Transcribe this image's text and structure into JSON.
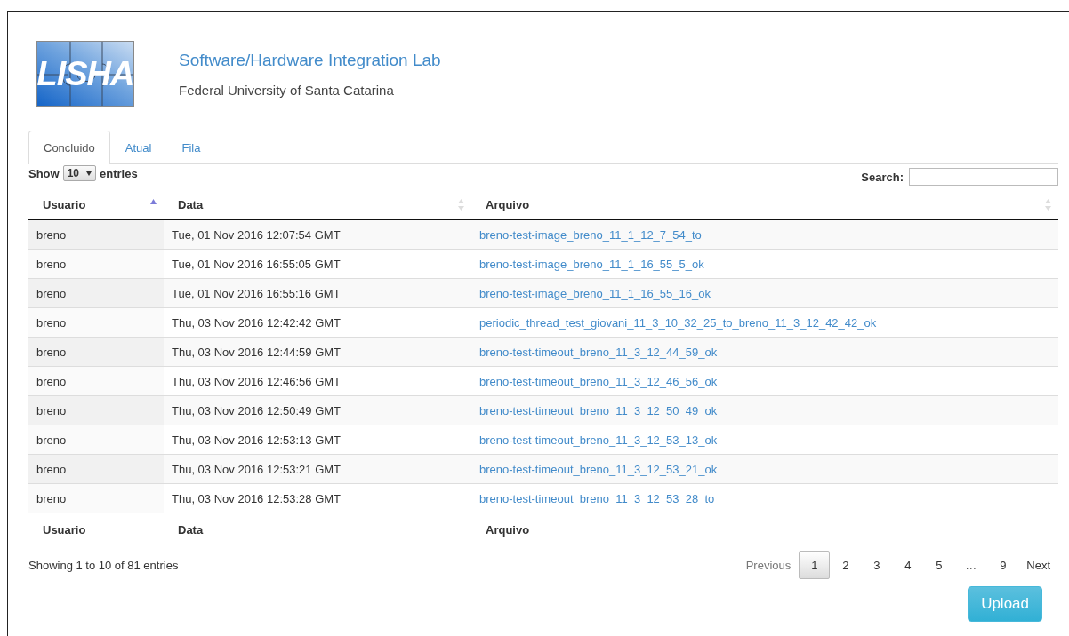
{
  "header": {
    "logo_text": "LISHA",
    "title": "Software/Hardware Integration Lab",
    "subtitle": "Federal University of Santa Catarina"
  },
  "tabs": [
    {
      "label": "Concluido",
      "selected": true
    },
    {
      "label": "Atual",
      "selected": false
    },
    {
      "label": "Fila",
      "selected": false
    }
  ],
  "length_menu": {
    "before": "Show",
    "value": "10",
    "after": "entries"
  },
  "search": {
    "label": "Search:"
  },
  "table": {
    "columns": [
      {
        "label": "Usuario",
        "sorted": true
      },
      {
        "label": "Data",
        "sorted": false
      },
      {
        "label": "Arquivo",
        "sorted": false
      }
    ],
    "rows": [
      {
        "user": "breno",
        "date": "Tue, 01 Nov 2016 12:07:54 GMT",
        "file": "breno-test-image_breno_11_1_12_7_54_to"
      },
      {
        "user": "breno",
        "date": "Tue, 01 Nov 2016 16:55:05 GMT",
        "file": "breno-test-image_breno_11_1_16_55_5_ok"
      },
      {
        "user": "breno",
        "date": "Tue, 01 Nov 2016 16:55:16 GMT",
        "file": "breno-test-image_breno_11_1_16_55_16_ok"
      },
      {
        "user": "breno",
        "date": "Thu, 03 Nov 2016 12:42:42 GMT",
        "file": "periodic_thread_test_giovani_11_3_10_32_25_to_breno_11_3_12_42_42_ok"
      },
      {
        "user": "breno",
        "date": "Thu, 03 Nov 2016 12:44:59 GMT",
        "file": "breno-test-timeout_breno_11_3_12_44_59_ok"
      },
      {
        "user": "breno",
        "date": "Thu, 03 Nov 2016 12:46:56 GMT",
        "file": "breno-test-timeout_breno_11_3_12_46_56_ok"
      },
      {
        "user": "breno",
        "date": "Thu, 03 Nov 2016 12:50:49 GMT",
        "file": "breno-test-timeout_breno_11_3_12_50_49_ok"
      },
      {
        "user": "breno",
        "date": "Thu, 03 Nov 2016 12:53:13 GMT",
        "file": "breno-test-timeout_breno_11_3_12_53_13_ok"
      },
      {
        "user": "breno",
        "date": "Thu, 03 Nov 2016 12:53:21 GMT",
        "file": "breno-test-timeout_breno_11_3_12_53_21_ok"
      },
      {
        "user": "breno",
        "date": "Thu, 03 Nov 2016 12:53:28 GMT",
        "file": "breno-test-timeout_breno_11_3_12_53_28_to"
      }
    ],
    "footer": [
      "Usuario",
      "Data",
      "Arquivo"
    ]
  },
  "info": "Showing 1 to 10 of 81 entries",
  "pagination": [
    {
      "label": "Previous",
      "kind": "prev",
      "disabled": true
    },
    {
      "label": "1",
      "kind": "page",
      "selected": true
    },
    {
      "label": "2",
      "kind": "page",
      "selected": false
    },
    {
      "label": "3",
      "kind": "page",
      "selected": false
    },
    {
      "label": "4",
      "kind": "page",
      "selected": false
    },
    {
      "label": "5",
      "kind": "page",
      "selected": false
    },
    {
      "label": "…",
      "kind": "ellipsis"
    },
    {
      "label": "9",
      "kind": "page",
      "selected": false
    },
    {
      "label": "Next",
      "kind": "next",
      "disabled": false
    }
  ],
  "upload_button": "Upload"
}
